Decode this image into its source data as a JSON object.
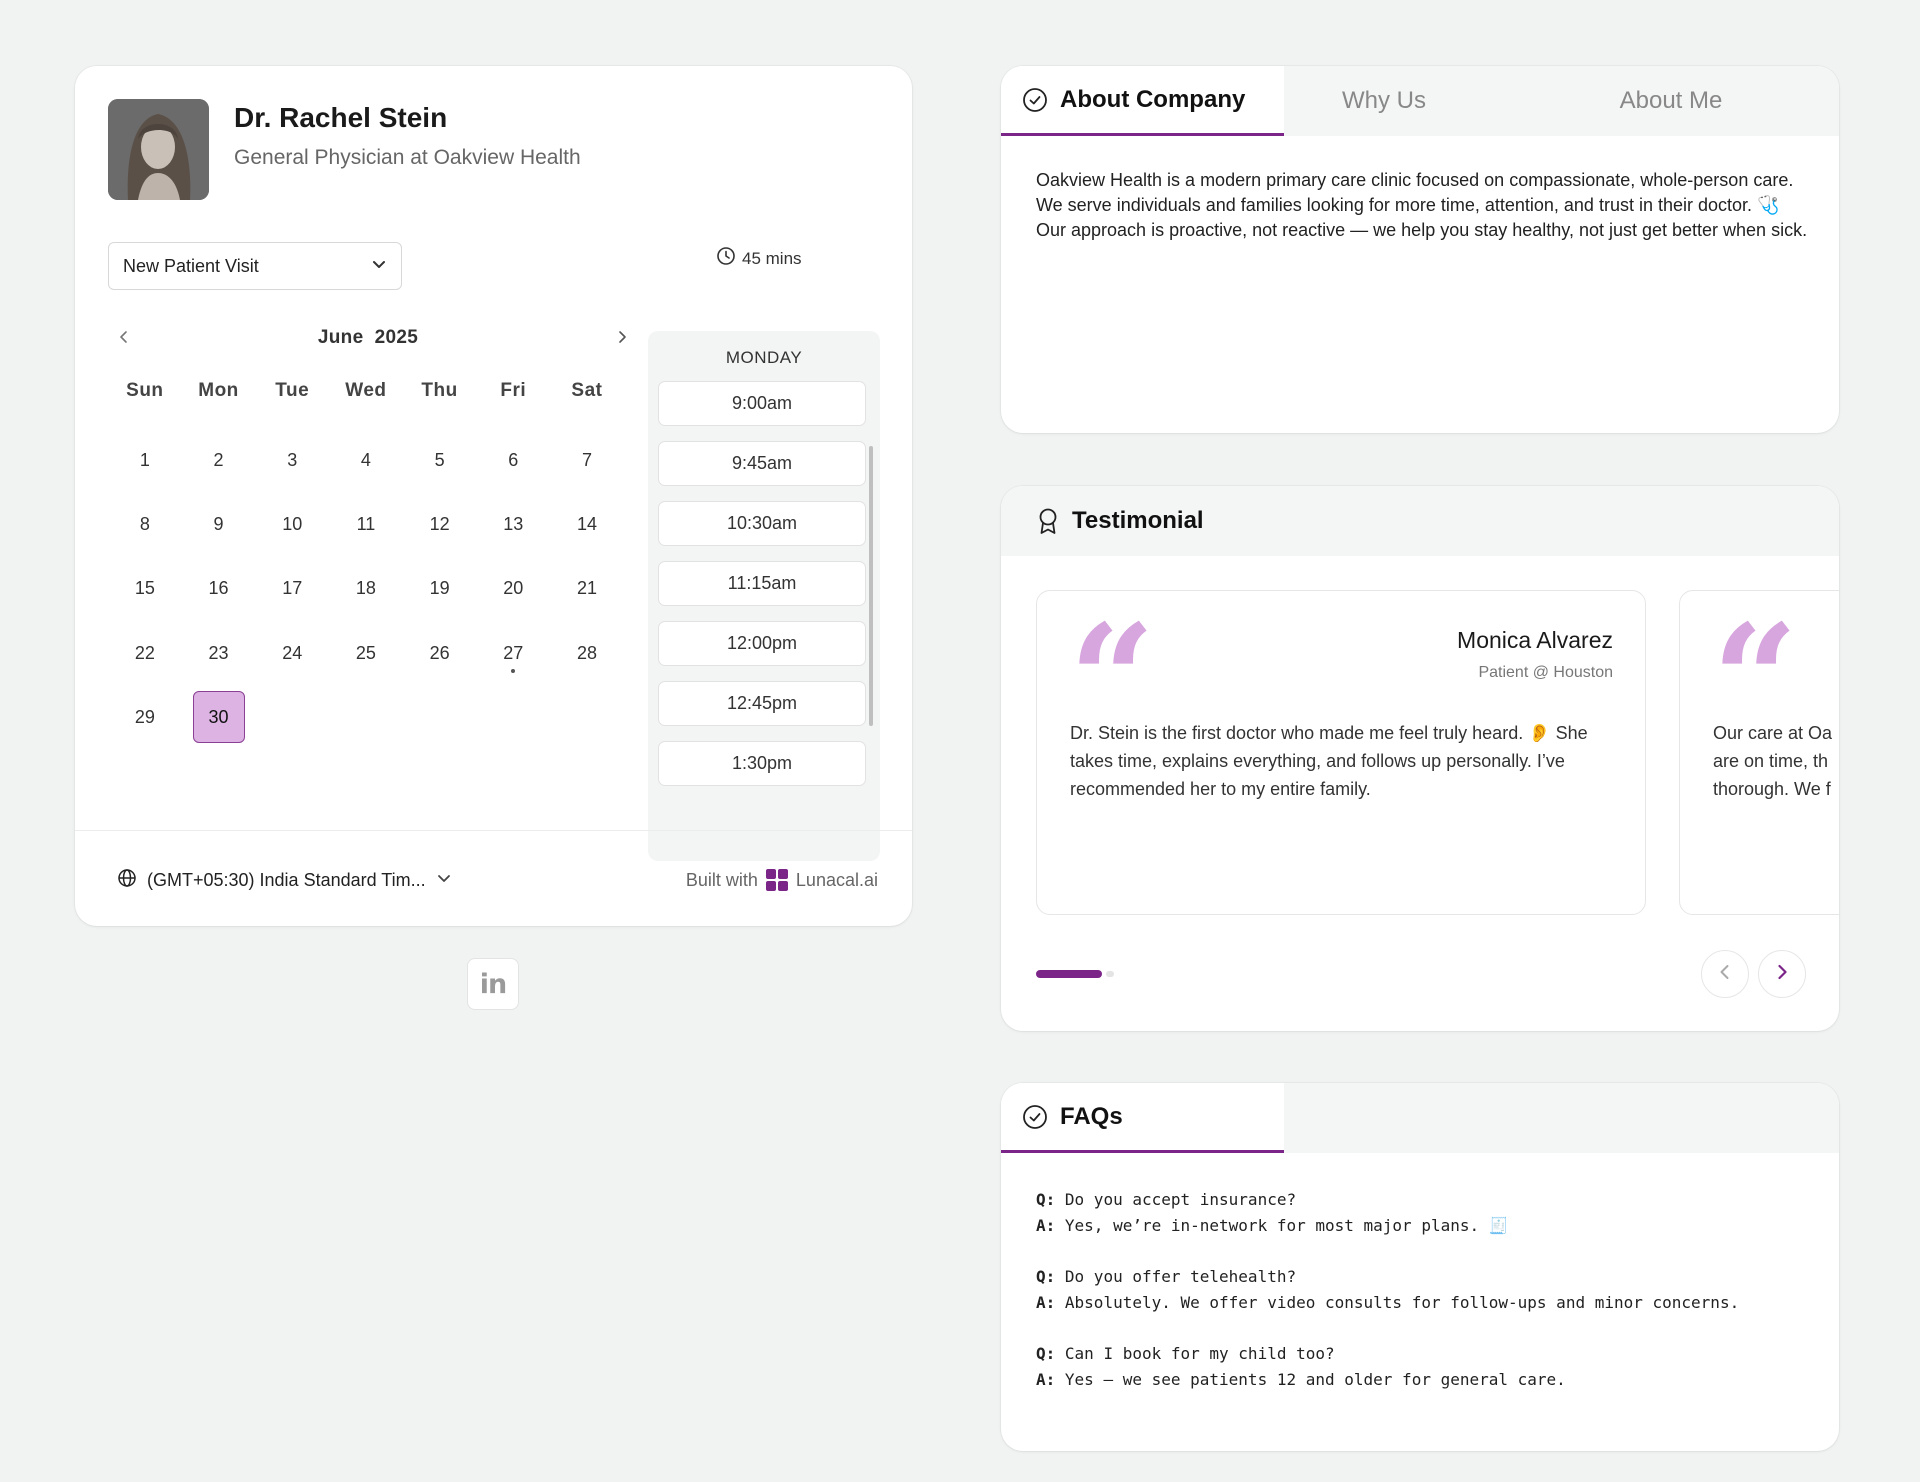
{
  "doctor": {
    "name": "Dr. Rachel Stein",
    "role": "General Physician at Oakview Health"
  },
  "booking": {
    "visit_type": "New Patient Visit",
    "duration": "45 mins",
    "calendar": {
      "month": "June",
      "year": "2025",
      "weekdays": [
        "Sun",
        "Mon",
        "Tue",
        "Wed",
        "Thu",
        "Fri",
        "Sat"
      ],
      "days": [
        "1",
        "2",
        "3",
        "4",
        "5",
        "6",
        "7",
        "8",
        "9",
        "10",
        "11",
        "12",
        "13",
        "14",
        "15",
        "16",
        "17",
        "18",
        "19",
        "20",
        "21",
        "22",
        "23",
        "24",
        "25",
        "26",
        "27",
        "28",
        "29",
        "30"
      ],
      "selected_day": "30",
      "today_marker_day": "27"
    },
    "slots": {
      "day_label": "MONDAY",
      "times": [
        "9:00am",
        "9:45am",
        "10:30am",
        "11:15am",
        "12:00pm",
        "12:45pm",
        "1:30pm"
      ]
    },
    "timezone": "(GMT+05:30) India Standard Tim...",
    "built_with_label": "Built with",
    "brand": "Lunacal.ai"
  },
  "social": {
    "linkedin_label": "in"
  },
  "about": {
    "tabs": [
      "About Company",
      "Why Us",
      "About Me"
    ],
    "active_tab": "About Company",
    "text_1": "Oakview Health is a modern primary care clinic focused on compassionate, whole-person care. We serve individuals and families looking for more time, attention, and trust in their doctor.",
    "emoji_1": "🩺",
    "text_2": "Our approach is proactive, not reactive — we help you stay healthy, not just get better when sick."
  },
  "testimonial": {
    "title": "Testimonial",
    "items": [
      {
        "name": "Monica Alvarez",
        "role": "Patient @ Houston",
        "text_1": "Dr. Stein is the first doctor who made me feel truly heard.",
        "emoji": "👂",
        "text_2": "She takes time, explains everything, and follows up personally. I’ve recommended her to my entire family."
      },
      {
        "name": "",
        "role": "",
        "text_1": "Our care at Oa",
        "emoji": "",
        "text_2": "are on time, th thorough. We f"
      }
    ],
    "progress": 0.85
  },
  "faqs": {
    "title": "FAQs",
    "q_prefix": "Q:",
    "a_prefix": "A:",
    "items": [
      {
        "q": "Do you accept insurance?",
        "a": "Yes, we’re in-network for most major plans. 🧾"
      },
      {
        "q": "Do you offer telehealth?",
        "a": "Absolutely. We offer video consults for follow-ups and minor concerns."
      },
      {
        "q": "Can I book for my child too?",
        "a": "Yes — we see patients 12 and older for general care."
      }
    ]
  },
  "colors": {
    "accent": "#7c2589",
    "selected_day_bg": "#dcb3e3",
    "quote_mark": "#d8a6df"
  },
  "icons": {
    "duration": "clock-icon",
    "timezone": "globe-icon",
    "about_tab": "check-circle-icon",
    "testimonial": "award-icon",
    "faqs_tab": "check-circle-icon"
  }
}
